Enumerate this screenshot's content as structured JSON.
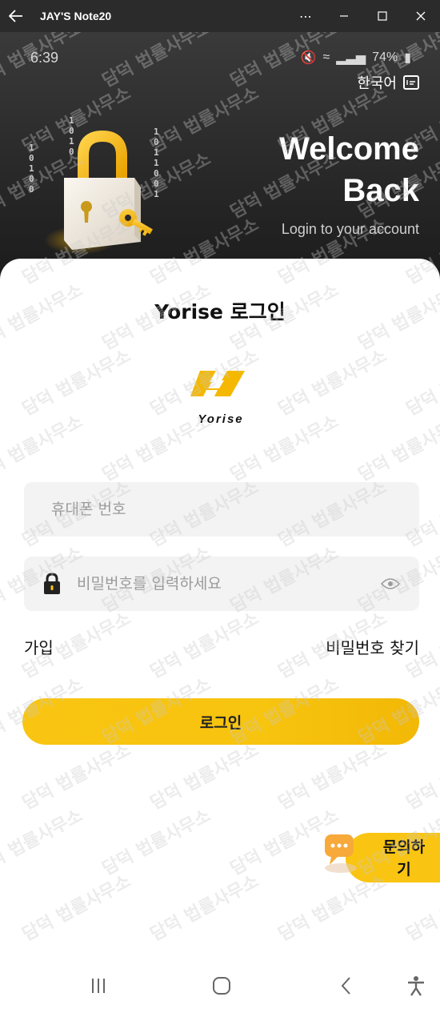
{
  "window": {
    "title": "JAY'S Note20",
    "back_icon": "arrow-left-icon",
    "controls": [
      "more-icon",
      "minimize-icon",
      "maximize-icon",
      "close-icon"
    ]
  },
  "status_bar": {
    "time": "6:39",
    "battery": "74%"
  },
  "hero": {
    "language": "한국어",
    "welcome_line1": "Welcome",
    "welcome_line2": "Back",
    "subtitle": "Login to your account"
  },
  "login": {
    "title": "Yorise 로그인",
    "logo_text": "Yorise",
    "phone_placeholder": "휴대폰 번호",
    "password_placeholder": "비밀번호를 입력하세요",
    "signup_label": "가입",
    "forgot_label": "비밀번호 찾기",
    "login_button": "로그인"
  },
  "inquiry": {
    "line1": "문의하",
    "line2": "기"
  },
  "watermark": {
    "text": "담덕 법률사무소"
  },
  "colors": {
    "accent": "#F9C512",
    "hero_bg": "#2A2A2A",
    "field_bg": "#F3F3F3"
  }
}
